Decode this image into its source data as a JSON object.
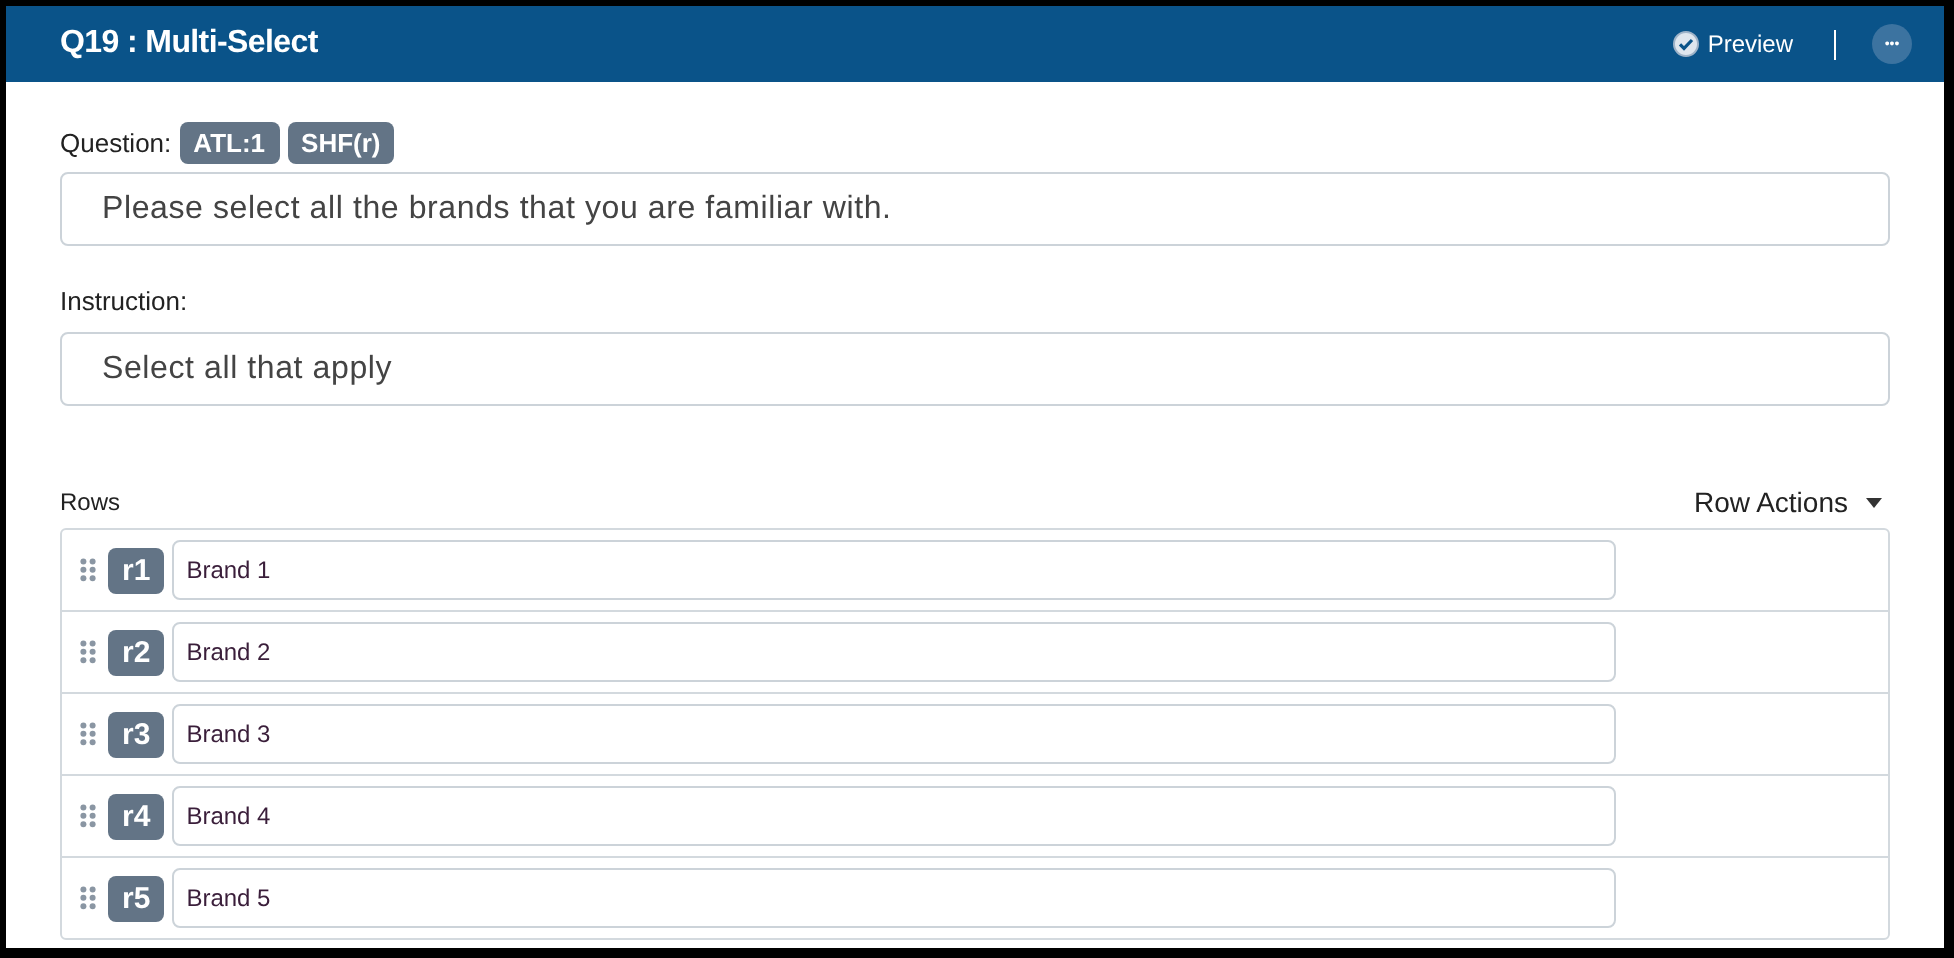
{
  "header": {
    "title": "Q19 : Multi-Select",
    "preview": "Preview",
    "more": "•••"
  },
  "question": {
    "label": "Question:",
    "tags": [
      "ATL:1",
      "SHF(r)"
    ],
    "value": "Please select all the brands that you are familiar with."
  },
  "instruction": {
    "label": "Instruction:",
    "value": "Select all that apply"
  },
  "rows_section": {
    "label": "Rows",
    "actions": "Row Actions"
  },
  "rows": [
    {
      "code": "r1",
      "value": "Brand 1"
    },
    {
      "code": "r2",
      "value": "Brand 2"
    },
    {
      "code": "r3",
      "value": "Brand 3"
    },
    {
      "code": "r4",
      "value": "Brand 4"
    },
    {
      "code": "r5",
      "value": "Brand 5"
    }
  ]
}
